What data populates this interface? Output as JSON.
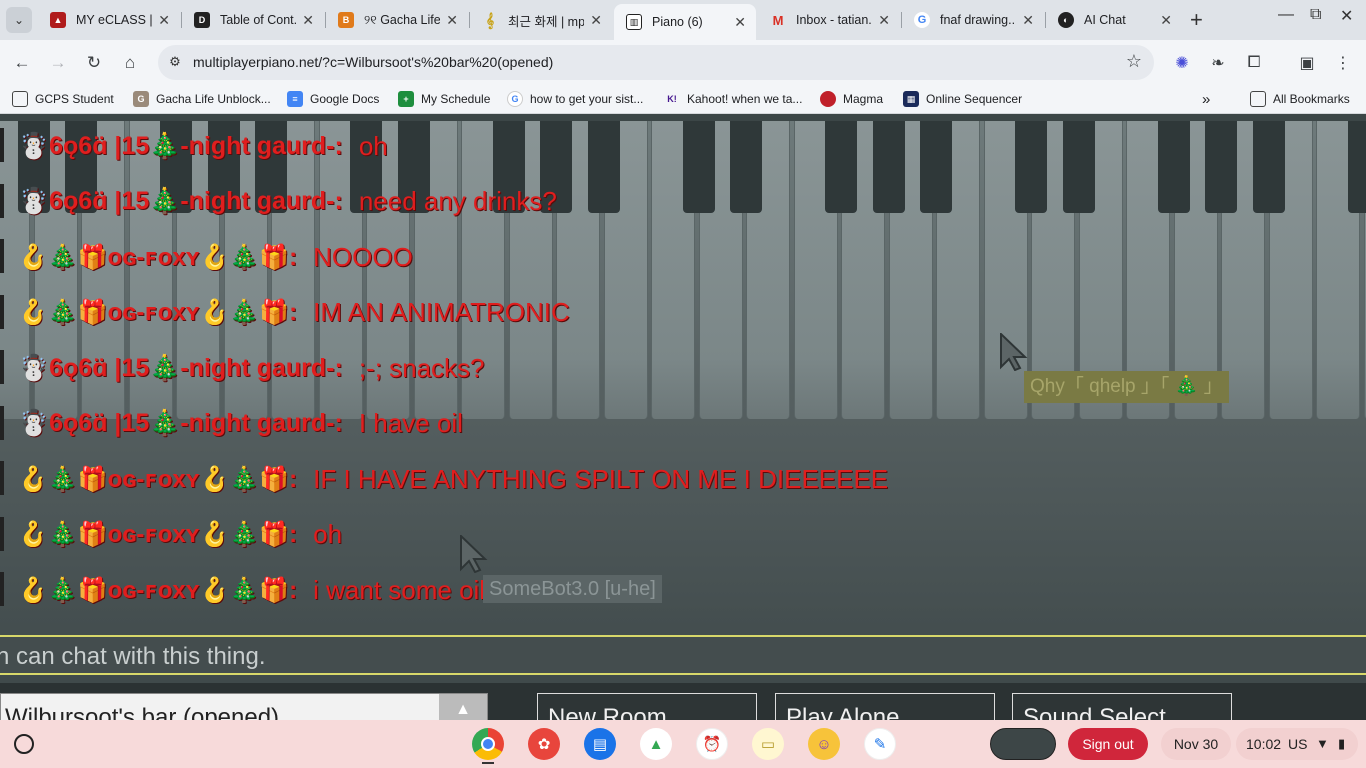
{
  "tabs": [
    {
      "title": "MY eCLASS | ...",
      "favicon": "eclass-icon",
      "color": "#b01c1c"
    },
    {
      "title": "Table of Cont...",
      "favicon": "d2l-icon",
      "color": "#222222"
    },
    {
      "title": "୨୧ Gacha Life ...",
      "favicon": "gacha-icon",
      "color": "#e07a1a"
    },
    {
      "title": "최근 화제 | mp...",
      "favicon": "music-note-icon",
      "color": "#c8a318"
    },
    {
      "title": "Piano (6)",
      "favicon": "piano-icon",
      "color": "#222222"
    },
    {
      "title": "Inbox - tatian...",
      "favicon": "gmail-icon",
      "color": "#d93025"
    },
    {
      "title": "fnaf drawing...",
      "favicon": "google-icon",
      "color": "#4285f4"
    },
    {
      "title": "AI Chat",
      "favicon": "ai-chat-icon",
      "color": "#222222"
    }
  ],
  "url": "multiplayerpiano.net/?c=Wilbursoot's%20bar%20(opened)",
  "bookmarks": [
    {
      "label": "GCPS Student",
      "icon": "folder-icon"
    },
    {
      "label": "Gacha Life Unblock...",
      "icon": "gacha-icon"
    },
    {
      "label": "Google Docs",
      "icon": "docs-icon"
    },
    {
      "label": "My Schedule",
      "icon": "schedule-icon"
    },
    {
      "label": "how to get your sist...",
      "icon": "google-icon"
    },
    {
      "label": "Kahoot! when we ta...",
      "icon": "kahoot-icon"
    },
    {
      "label": "Magma",
      "icon": "magma-icon"
    },
    {
      "label": "Online Sequencer",
      "icon": "sequencer-icon"
    }
  ],
  "all_bookmarks": "All Bookmarks",
  "chat": [
    {
      "name": "☃️6ǫ6ɑ̈ |15🎄-night gaurd-:",
      "text": "oh",
      "type": "guard"
    },
    {
      "name": "☃️6ǫ6ɑ̈ |15🎄-night gaurd-:",
      "text": "need any drinks?",
      "type": "guard"
    },
    {
      "name": "🪝🎄🎁ᴏɢ-ꜰᴏxʏ🪝🎄🎁:",
      "text": "NOOOO",
      "type": "foxy"
    },
    {
      "name": "🪝🎄🎁ᴏɢ-ꜰᴏxʏ🪝🎄🎁:",
      "text": "IM AN ANIMATRONIC",
      "type": "foxy"
    },
    {
      "name": "☃️6ǫ6ɑ̈ |15🎄-night gaurd-:",
      "text": ";-; snacks?",
      "type": "guard"
    },
    {
      "name": "☃️6ǫ6ɑ̈ |15🎄-night gaurd-:",
      "text": "I have oil",
      "type": "guard"
    },
    {
      "name": "🪝🎄🎁ᴏɢ-ꜰᴏxʏ🪝🎄🎁:",
      "text": "IF I HAVE ANYTHING SPILT ON ME I DIEEEEEE",
      "type": "foxy"
    },
    {
      "name": "🪝🎄🎁ᴏɢ-ꜰᴏxʏ🪝🎄🎁:",
      "text": "oh",
      "type": "foxy"
    },
    {
      "name": "🪝🎄🎁ᴏɢ-ꜰᴏxʏ🪝🎄🎁:",
      "text": "i want some oil",
      "type": "foxy"
    }
  ],
  "cursor_tags": {
    "tag1": "Qhy「 qhelp 」「 🎄 」",
    "tag2": "SomeBot3.0 [u-he]"
  },
  "chat_input": {
    "placeholder": "n can chat with this thing."
  },
  "room_name": "Wilbursoot's bar (opened)",
  "buttons": {
    "new_room": "New Room",
    "play_alone": "Play Alone",
    "sound_select": "Sound Select"
  },
  "shelf": {
    "apps": [
      "chrome-icon",
      "palette-icon",
      "classroom-icon",
      "drive-icon",
      "clock-icon",
      "notes-icon",
      "avatar-app-icon",
      "pen-app-icon"
    ],
    "sign_out": "Sign out",
    "date": "Nov 30",
    "time": "10:02",
    "locale": "US"
  },
  "colors": {
    "chat_red": "#e01e1e",
    "chat_border": "#d8d86a",
    "signout": "#d0263b"
  }
}
